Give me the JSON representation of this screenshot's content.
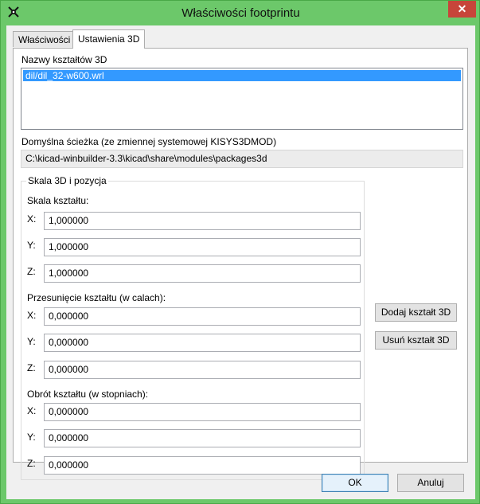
{
  "window": {
    "title": "Właściwości footprintu",
    "close_glyph": "✕"
  },
  "tabs": [
    {
      "label": "Właściwości",
      "active": false
    },
    {
      "label": "Ustawienia 3D",
      "active": true
    }
  ],
  "shapes": {
    "label": "Nazwy kształtów 3D",
    "items": [
      "dil/dil_32-w600.wrl"
    ],
    "selected_index": 0
  },
  "default_path": {
    "label": "Domyślna ścieżka (ze zmiennej systemowej KISYS3DMOD)",
    "value": "C:\\kicad-winbuilder-3.3\\kicad\\share\\modules\\packages3d"
  },
  "scale_position": {
    "legend": "Skala 3D i pozycja",
    "scale": {
      "label": "Skala kształtu:",
      "x_label": "X:",
      "x": "1,000000",
      "y_label": "Y:",
      "y": "1,000000",
      "z_label": "Z:",
      "z": "1,000000"
    },
    "offset": {
      "label": "Przesunięcie kształtu (w calach):",
      "x_label": "X:",
      "x": "0,000000",
      "y_label": "Y:",
      "y": "0,000000",
      "z_label": "Z:",
      "z": "0,000000"
    },
    "rotation": {
      "label": "Obrót kształtu (w stopniach):",
      "x_label": "X:",
      "x": "0,000000",
      "y_label": "Y:",
      "y": "0,000000",
      "z_label": "Z:",
      "z": "0,000000"
    }
  },
  "buttons": {
    "add_shape": "Dodaj kształt 3D",
    "remove_shape": "Usuń kształt 3D",
    "ok": "OK",
    "cancel": "Anuluj"
  },
  "colors": {
    "frame": "#6cc86a",
    "close": "#c7453a",
    "selection": "#3399ff"
  },
  "icons": {
    "app": "kicad-app-icon",
    "close": "close-icon"
  }
}
